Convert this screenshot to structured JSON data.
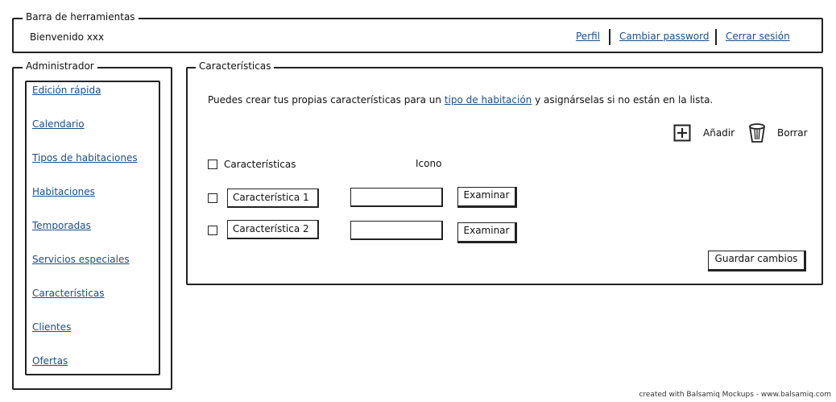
{
  "toolbar": {
    "legend": "Barra de herramientas",
    "welcome": "Bienvenido xxx",
    "links": {
      "profile": "Perfil",
      "change_password": "Cambiar password",
      "logout": "Cerrar sesión"
    }
  },
  "admin": {
    "legend": "Administrador",
    "items": [
      "Edición rápida",
      "Calendario",
      "Tipos de habitaciones",
      "Habitaciones",
      "Temporadas",
      "Servicios especiales",
      "Características",
      "Clientes",
      "Ofertas"
    ]
  },
  "main": {
    "legend": "Características",
    "intro_before": "Puedes crear tus propias características para un ",
    "intro_link": "tipo de habitación",
    "intro_after": " y asignárselas si no están en la lista.",
    "actions": {
      "add": "Añadir",
      "delete": "Borrar"
    },
    "table": {
      "headers": {
        "name": "Características",
        "icon": "Icono"
      },
      "rows": [
        {
          "name": "Característica 1",
          "icon": "",
          "button": "Examinar"
        },
        {
          "name": "Característica 2",
          "icon": "",
          "button": "Examinar"
        }
      ]
    },
    "save": "Guardar cambios"
  },
  "footer": "created with Balsamiq Mockups - www.balsamiq.com"
}
